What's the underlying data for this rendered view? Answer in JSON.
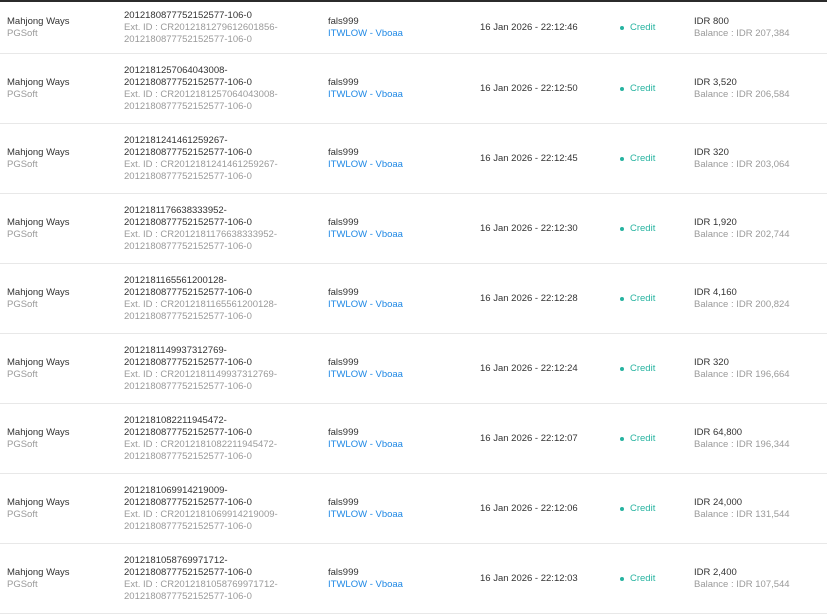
{
  "rows": [
    {
      "game": "Mahjong Ways",
      "provider": "PGSoft",
      "tx_lines": [
        "2012180877752152577-106-0"
      ],
      "ext_lines": [
        "Ext. ID : CR2012181279612601856-",
        "2012180877752152577-106-0"
      ],
      "user": "fals999",
      "agent": "ITWLOW - Vboaa",
      "datetime": "16 Jan 2026 - 22:12:46",
      "type": "Credit",
      "amount": "IDR 800",
      "balance": "Balance : IDR 207,384"
    },
    {
      "game": "Mahjong Ways",
      "provider": "PGSoft",
      "tx_lines": [
        "2012181257064043008-",
        "2012180877752152577-106-0"
      ],
      "ext_lines": [
        "Ext. ID : CR2012181257064043008-",
        "2012180877752152577-106-0"
      ],
      "user": "fals999",
      "agent": "ITWLOW - Vboaa",
      "datetime": "16 Jan 2026 - 22:12:50",
      "type": "Credit",
      "amount": "IDR 3,520",
      "balance": "Balance : IDR 206,584"
    },
    {
      "game": "Mahjong Ways",
      "provider": "PGSoft",
      "tx_lines": [
        "2012181241461259267-",
        "2012180877752152577-106-0"
      ],
      "ext_lines": [
        "Ext. ID : CR2012181241461259267-",
        "2012180877752152577-106-0"
      ],
      "user": "fals999",
      "agent": "ITWLOW - Vboaa",
      "datetime": "16 Jan 2026 - 22:12:45",
      "type": "Credit",
      "amount": "IDR 320",
      "balance": "Balance : IDR 203,064"
    },
    {
      "game": "Mahjong Ways",
      "provider": "PGSoft",
      "tx_lines": [
        "2012181176638333952-",
        "2012180877752152577-106-0"
      ],
      "ext_lines": [
        "Ext. ID : CR2012181176638333952-",
        "2012180877752152577-106-0"
      ],
      "user": "fals999",
      "agent": "ITWLOW - Vboaa",
      "datetime": "16 Jan 2026 - 22:12:30",
      "type": "Credit",
      "amount": "IDR 1,920",
      "balance": "Balance : IDR 202,744"
    },
    {
      "game": "Mahjong Ways",
      "provider": "PGSoft",
      "tx_lines": [
        "2012181165561200128-",
        "2012180877752152577-106-0"
      ],
      "ext_lines": [
        "Ext. ID : CR2012181165561200128-",
        "2012180877752152577-106-0"
      ],
      "user": "fals999",
      "agent": "ITWLOW - Vboaa",
      "datetime": "16 Jan 2026 - 22:12:28",
      "type": "Credit",
      "amount": "IDR 4,160",
      "balance": "Balance : IDR 200,824"
    },
    {
      "game": "Mahjong Ways",
      "provider": "PGSoft",
      "tx_lines": [
        "2012181149937312769-",
        "2012180877752152577-106-0"
      ],
      "ext_lines": [
        "Ext. ID : CR2012181149937312769-",
        "2012180877752152577-106-0"
      ],
      "user": "fals999",
      "agent": "ITWLOW - Vboaa",
      "datetime": "16 Jan 2026 - 22:12:24",
      "type": "Credit",
      "amount": "IDR 320",
      "balance": "Balance : IDR 196,664"
    },
    {
      "game": "Mahjong Ways",
      "provider": "PGSoft",
      "tx_lines": [
        "2012181082211945472-",
        "2012180877752152577-106-0"
      ],
      "ext_lines": [
        "Ext. ID : CR2012181082211945472-",
        "2012180877752152577-106-0"
      ],
      "user": "fals999",
      "agent": "ITWLOW - Vboaa",
      "datetime": "16 Jan 2026 - 22:12:07",
      "type": "Credit",
      "amount": "IDR 64,800",
      "balance": "Balance : IDR 196,344"
    },
    {
      "game": "Mahjong Ways",
      "provider": "PGSoft",
      "tx_lines": [
        "2012181069914219009-",
        "2012180877752152577-106-0"
      ],
      "ext_lines": [
        "Ext. ID : CR2012181069914219009-",
        "2012180877752152577-106-0"
      ],
      "user": "fals999",
      "agent": "ITWLOW - Vboaa",
      "datetime": "16 Jan 2026 - 22:12:06",
      "type": "Credit",
      "amount": "IDR 24,000",
      "balance": "Balance : IDR 131,544"
    },
    {
      "game": "Mahjong Ways",
      "provider": "PGSoft",
      "tx_lines": [
        "2012181058769971712-",
        "2012180877752152577-106-0"
      ],
      "ext_lines": [
        "Ext. ID : CR2012181058769971712-",
        "2012180877752152577-106-0"
      ],
      "user": "fals999",
      "agent": "ITWLOW - Vboaa",
      "datetime": "16 Jan 2026 - 22:12:03",
      "type": "Credit",
      "amount": "IDR 2,400",
      "balance": "Balance : IDR 107,544"
    }
  ]
}
